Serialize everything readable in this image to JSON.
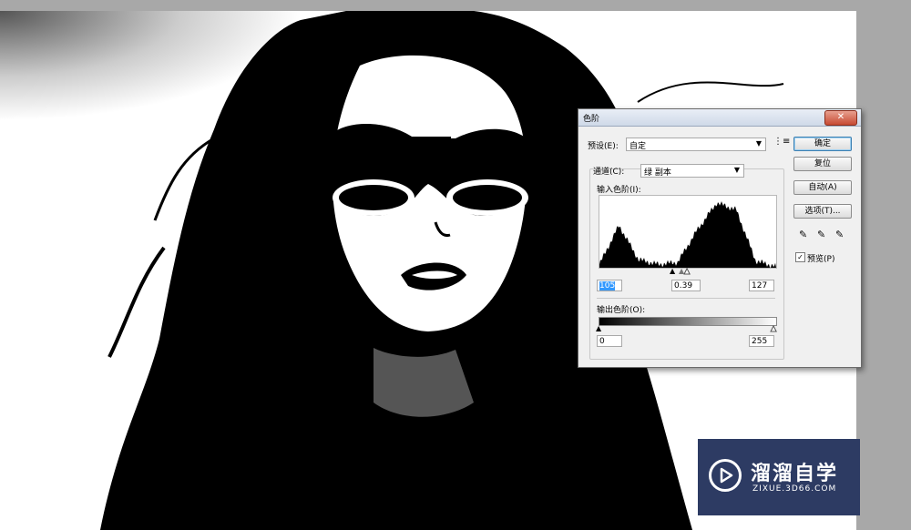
{
  "dialog": {
    "title": "色阶",
    "close_label": "✕",
    "preset": {
      "label": "预设(E):",
      "value": "自定"
    },
    "channel": {
      "label": "通道(C):",
      "value": "绿 副本"
    },
    "input_levels_label": "输入色阶(I):",
    "input_values": {
      "black": "105",
      "gamma": "0.39",
      "white": "127"
    },
    "output_levels_label": "输出色阶(O):",
    "output_values": {
      "black": "0",
      "white": "255"
    },
    "buttons": {
      "ok": "确定",
      "reset": "复位",
      "auto": "自动(A)",
      "options": "选项(T)..."
    },
    "preview": {
      "label": "预览(P)",
      "checked": true
    },
    "histogram_peaks": [
      0.05,
      0.62,
      0.12,
      0.05,
      0.08,
      0.55,
      0.95,
      0.85,
      0.1,
      0.02
    ]
  },
  "watermark": {
    "main": "溜溜自学",
    "sub": "ZIXUE.3D66.COM"
  },
  "colors": {
    "watermark_bg": "#2d3b63",
    "accent": "#3399ff",
    "close": "#c74a32"
  },
  "icons": {
    "menu": "menu-icon",
    "black_eyedropper": "eyedropper-icon",
    "gray_eyedropper": "eyedropper-icon",
    "white_eyedropper": "eyedropper-icon"
  }
}
